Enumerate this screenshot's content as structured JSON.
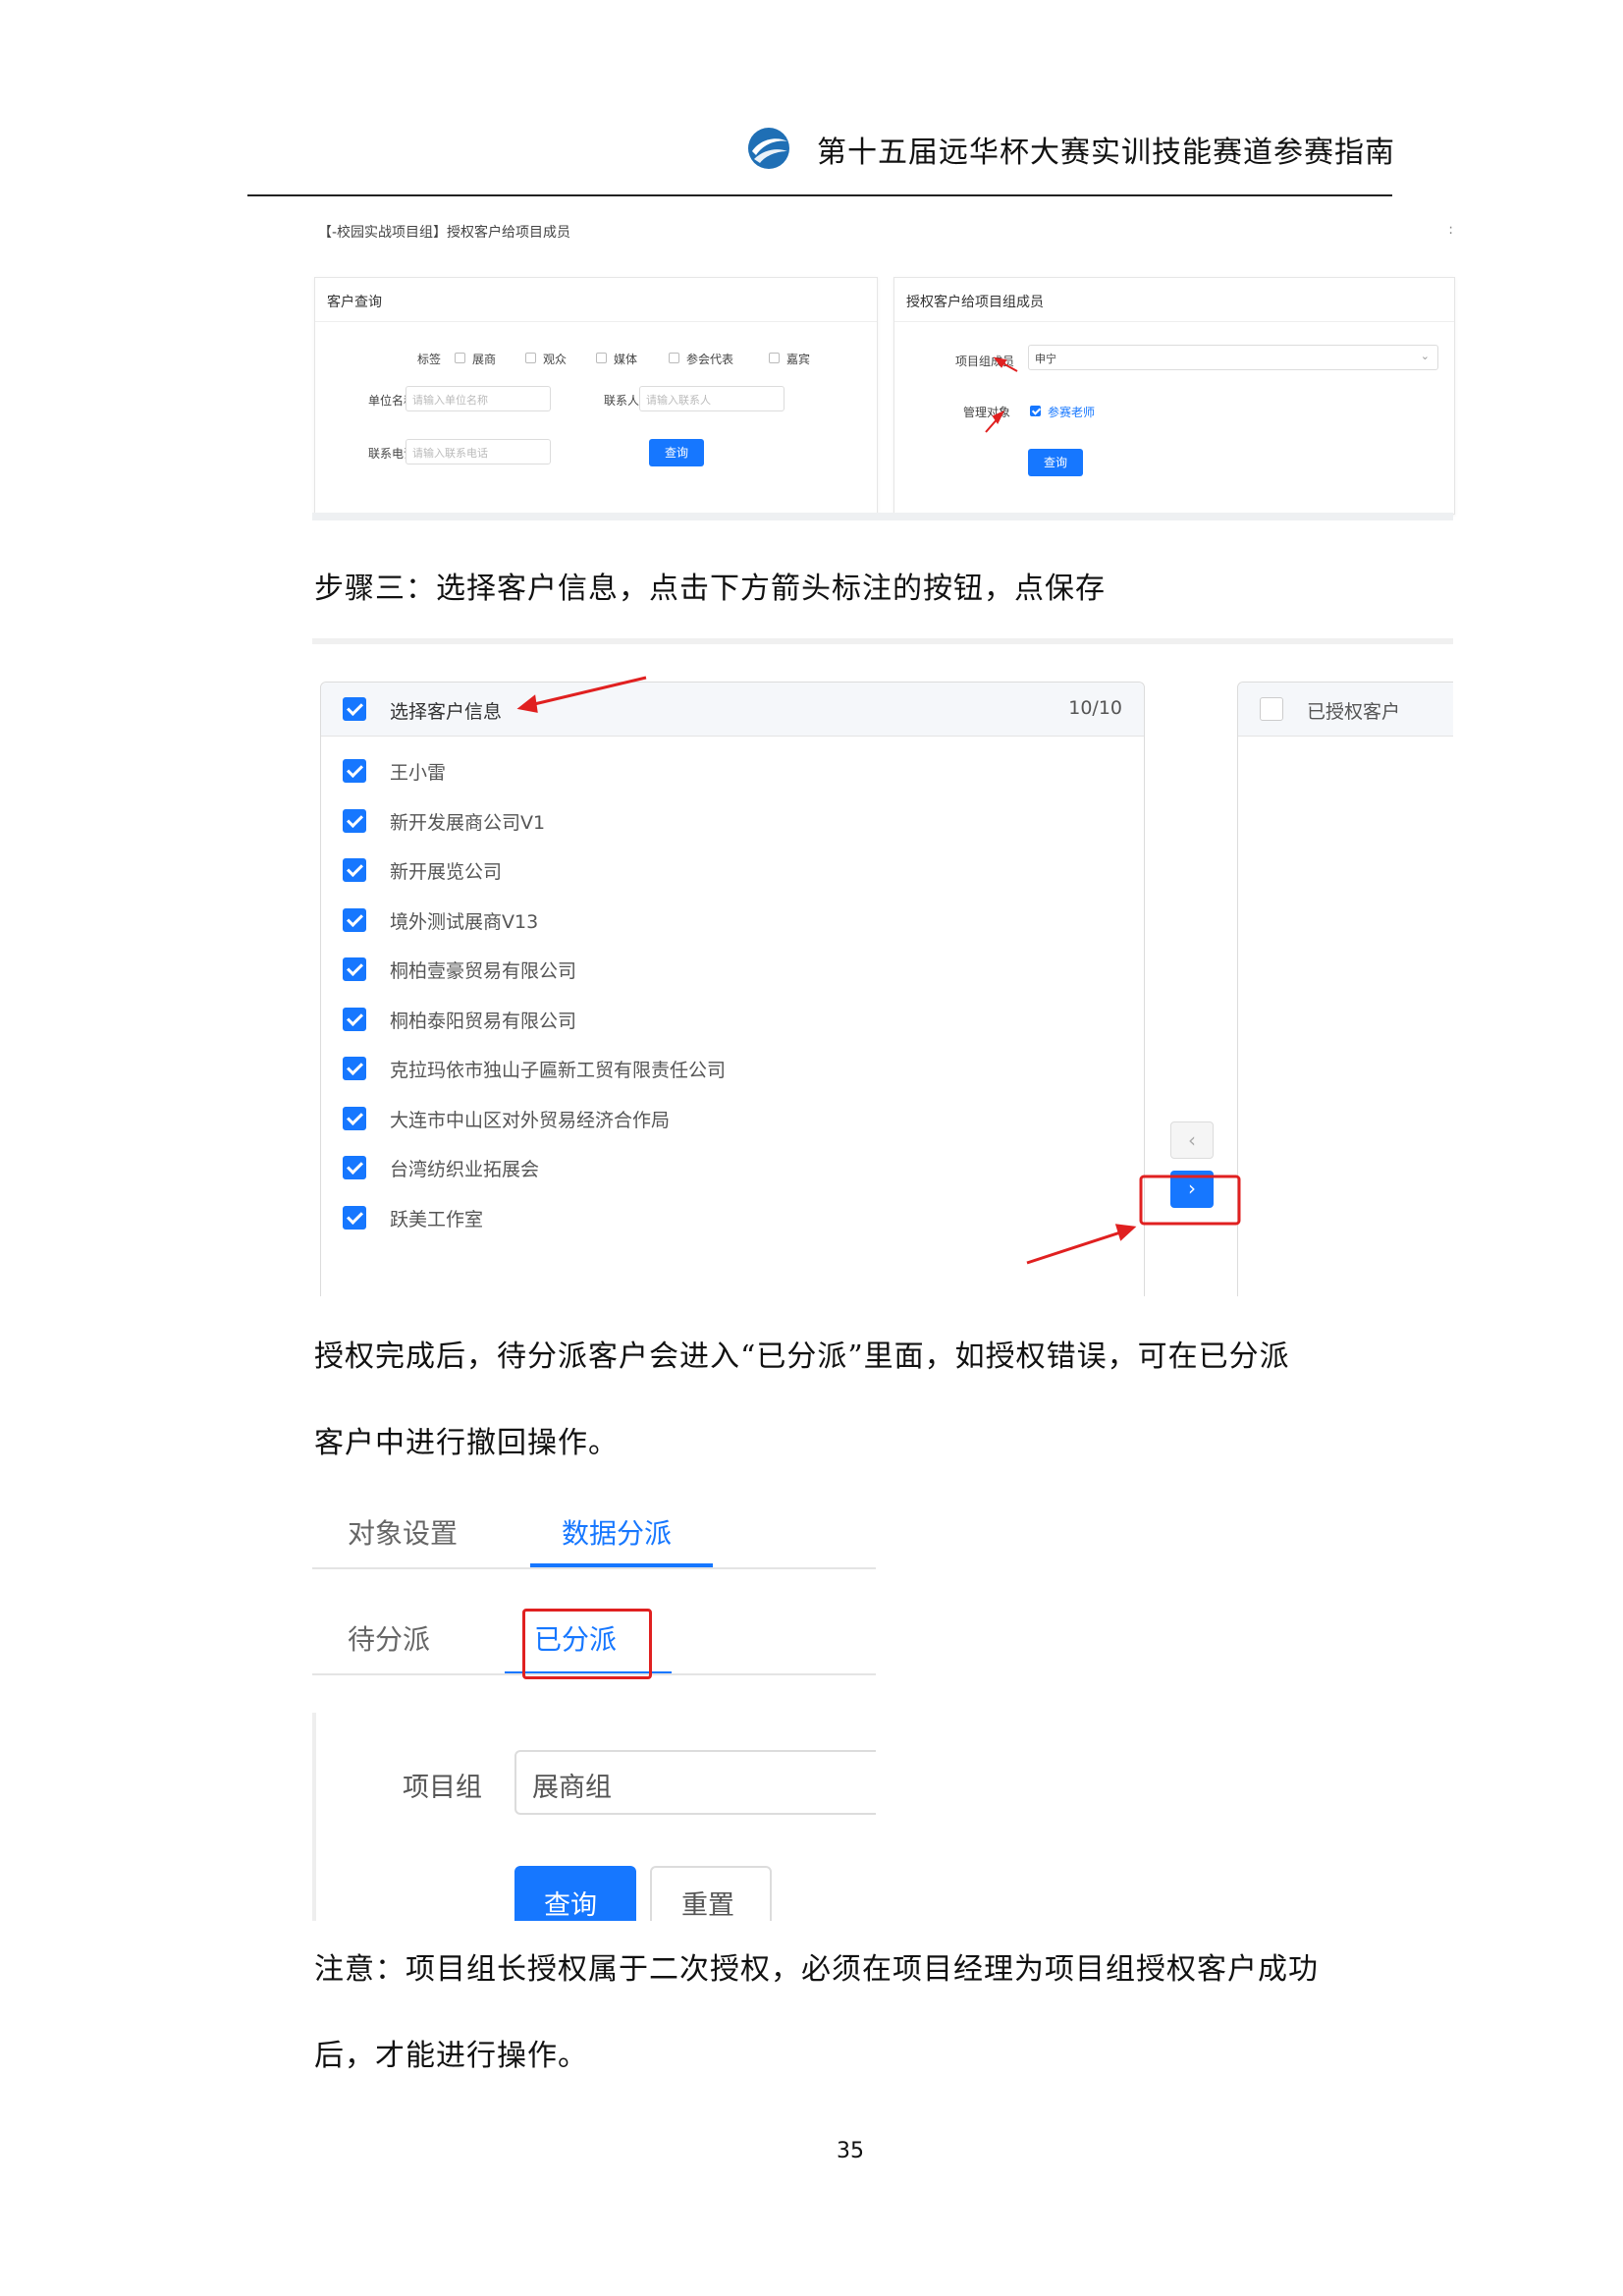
{
  "header": {
    "title": "第十五届远华杯大赛实训技能赛道参赛指南"
  },
  "screenshot1": {
    "breadcrumb": "【-校园实战项目组】授权客户给项目成员",
    "more": ":",
    "left_panel": {
      "title": "客户查询",
      "tag_label": "标签",
      "tags": [
        "展商",
        "观众",
        "媒体",
        "参会代表",
        "嘉宾"
      ],
      "company_label": "单位名称",
      "company_placeholder": "请输入单位名称",
      "contact_label": "联系人",
      "contact_placeholder": "请输入联系人",
      "phone_label": "联系电话",
      "phone_placeholder": "请输入联系电话",
      "search_button": "查询"
    },
    "right_panel": {
      "title": "授权客户给项目组成员",
      "member_label": "项目组成员",
      "member_value": "申宁",
      "target_label": "管理对象",
      "target_option": "参赛老师",
      "search_button": "查询"
    }
  },
  "paragraph1": "步骤三：选择客户信息，点击下方箭头标注的按钮，点保存",
  "screenshot2": {
    "left_list": {
      "header_label": "选择客户信息",
      "count": "10/10",
      "items": [
        "王小雷",
        "新开发展商公司V1",
        "新开展览公司",
        "境外测试展商V13",
        "桐柏壹豪贸易有限公司",
        "桐柏泰阳贸易有限公司",
        "克拉玛依市独山子匾新工贸有限责任公司",
        "大连市中山区对外贸易经济合作局",
        "台湾纺织业拓展会",
        "跃美工作室"
      ]
    },
    "right_list": {
      "header_label": "已授权客户"
    },
    "left_arrow": "‹",
    "right_arrow": "›"
  },
  "paragraph2_line1": "授权完成后，待分派客户会进入“已分派”里面，如授权错误，可在已分派",
  "paragraph2_line2": "客户中进行撤回操作。",
  "screenshot3": {
    "tabs": [
      "对象设置",
      "数据分派"
    ],
    "subtabs": [
      "待分派",
      "已分派"
    ],
    "group_label": "项目组",
    "group_value": "展商组",
    "query_button": "查询",
    "reset_button": "重置"
  },
  "paragraph3_line1": "注意：项目组长授权属于二次授权，必须在项目经理为项目组授权客户成功",
  "paragraph3_line2": "后，才能进行操作。",
  "page_number": "35",
  "colors": {
    "accent_blue": "#1677ff",
    "annotation_red": "#e02020"
  }
}
